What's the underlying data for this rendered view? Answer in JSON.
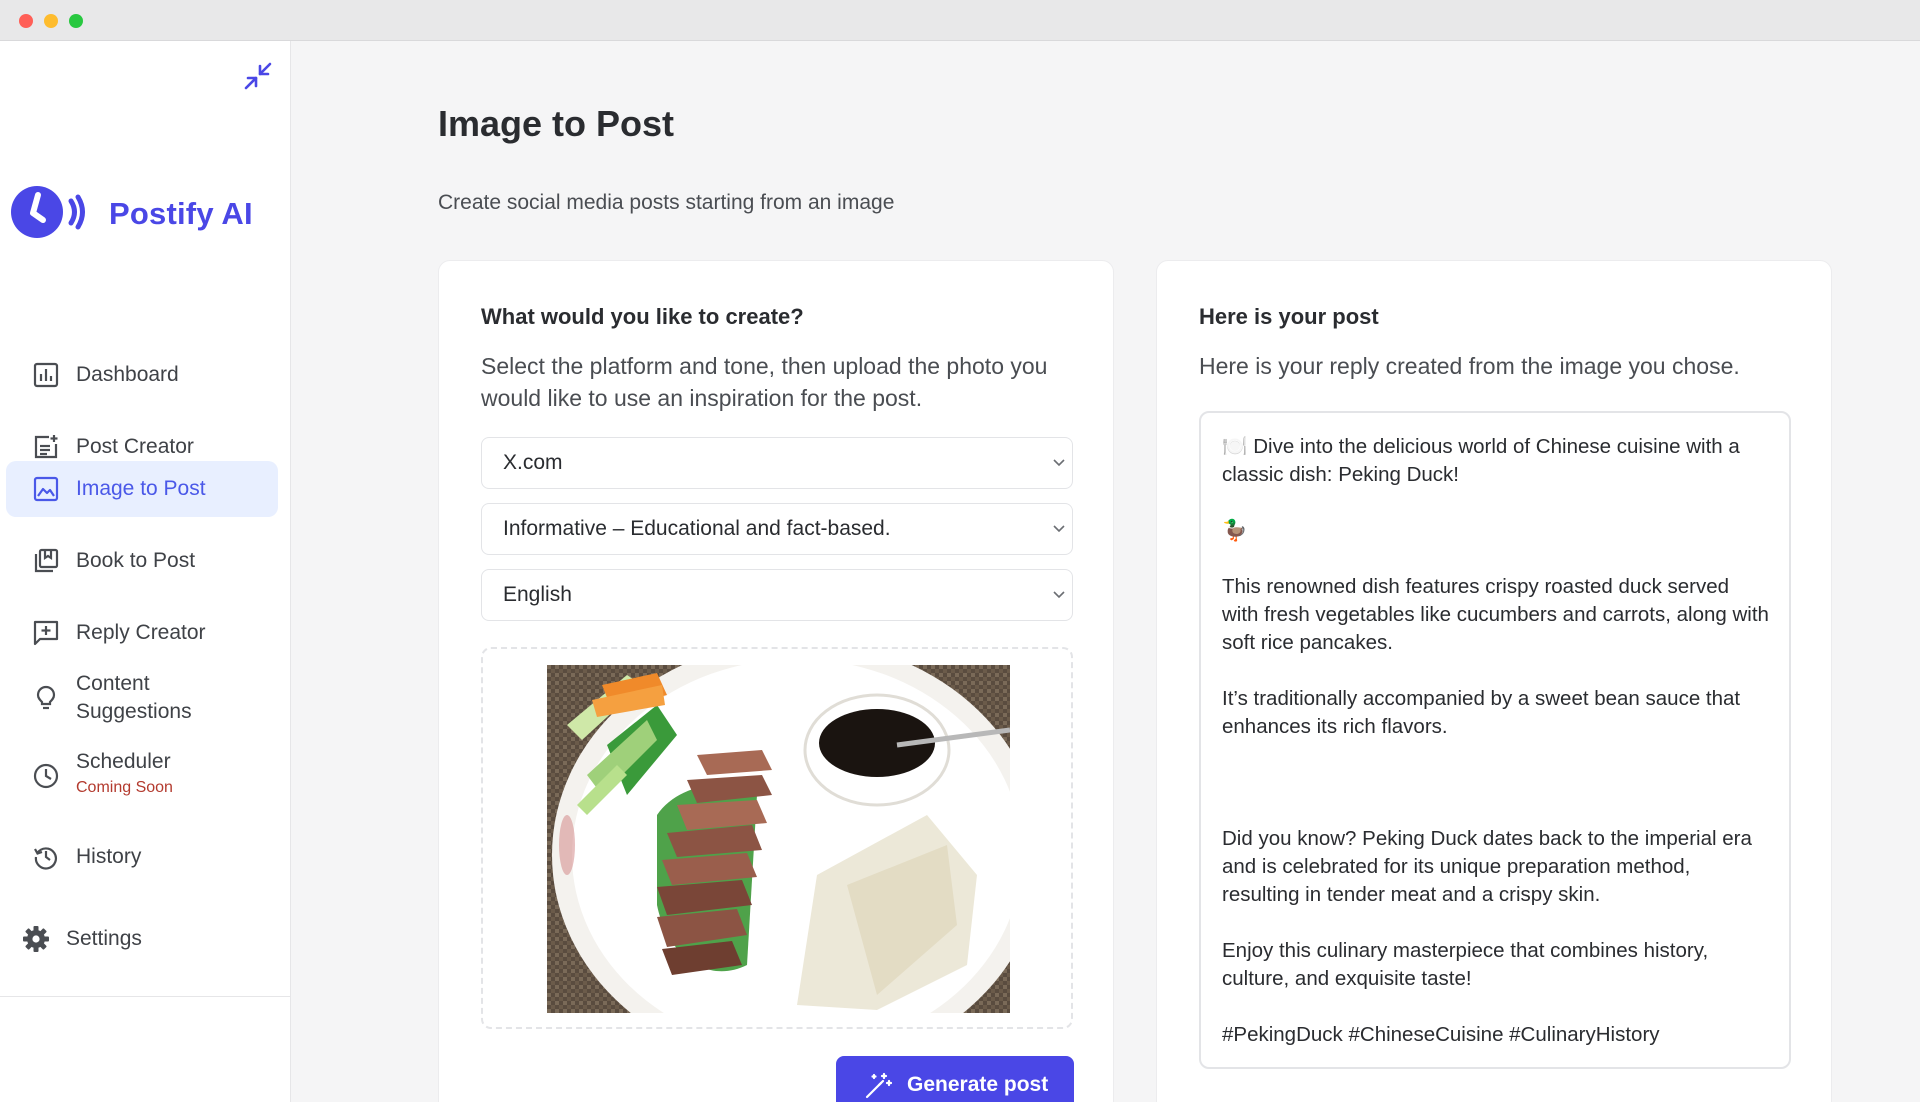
{
  "sidebar": {
    "logo_text": "Postify AI",
    "items": [
      {
        "label": "Dashboard",
        "icon": "bar-chart-icon"
      },
      {
        "label": "Post Creator",
        "icon": "post-add-icon"
      },
      {
        "label": "Image to Post",
        "icon": "image-icon"
      },
      {
        "label": "Book to Post",
        "icon": "book-icon"
      },
      {
        "label": "Reply Creator",
        "icon": "add-comment-icon"
      },
      {
        "label": "Content\nSuggestions",
        "icon": "lightbulb-icon"
      },
      {
        "label": "Scheduler",
        "sub": "Coming Soon",
        "icon": "clock-icon"
      },
      {
        "label": "History",
        "icon": "history-icon"
      }
    ],
    "settings_label": "Settings"
  },
  "page": {
    "title": "Image to Post",
    "subtitle": "Create social media posts starting from an image"
  },
  "create_card": {
    "title": "What would you like to create?",
    "description": "Select the platform and tone, then upload the photo you would like to use an inspiration for the post.",
    "platform": "X.com",
    "tone": "Informative – Educational and fact-based.",
    "language": "English",
    "generate_label": "Generate post"
  },
  "result_card": {
    "title": "Here is your post",
    "description": "Here is your reply created from the image you chose.",
    "post_lines": [
      "🍽️ Dive into the delicious world of Chinese cuisine with a classic dish: Peking Duck!",
      "",
      "🦆",
      "",
      "This renowned dish features crispy roasted duck served with fresh vegetables like cucumbers and carrots, along with soft rice pancakes.",
      "",
      "It’s traditionally accompanied by a sweet bean sauce that enhances its rich flavors.",
      "",
      "",
      "",
      "Did you know? Peking Duck dates back to the imperial era and is celebrated for its unique preparation method, resulting in tender meat and a crispy skin.",
      "",
      "Enjoy this culinary masterpiece that combines history, culture, and exquisite taste!",
      "",
      "#PekingDuck #ChineseCuisine #CulinaryHistory"
    ]
  },
  "colors": {
    "accent": "#4a47e6",
    "active_bg": "#e8efff",
    "coming_soon": "#b33a2e"
  }
}
